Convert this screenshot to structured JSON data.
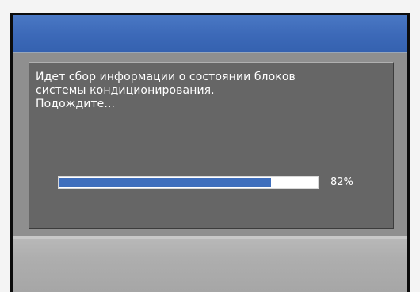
{
  "dialog": {
    "message": "Идет сбор информации о состоянии блоков\nсистемы кондиционирования.\nПодождите...",
    "progress": {
      "value": 0.82,
      "label": "82%"
    }
  },
  "colors": {
    "titlebar": "#3c69b8",
    "workarea": "#8f8f8f",
    "dialog": "#666666",
    "progress_fill": "#3f6fbd",
    "progress_track": "#ffffff",
    "bottombar": "#aeaeae"
  }
}
